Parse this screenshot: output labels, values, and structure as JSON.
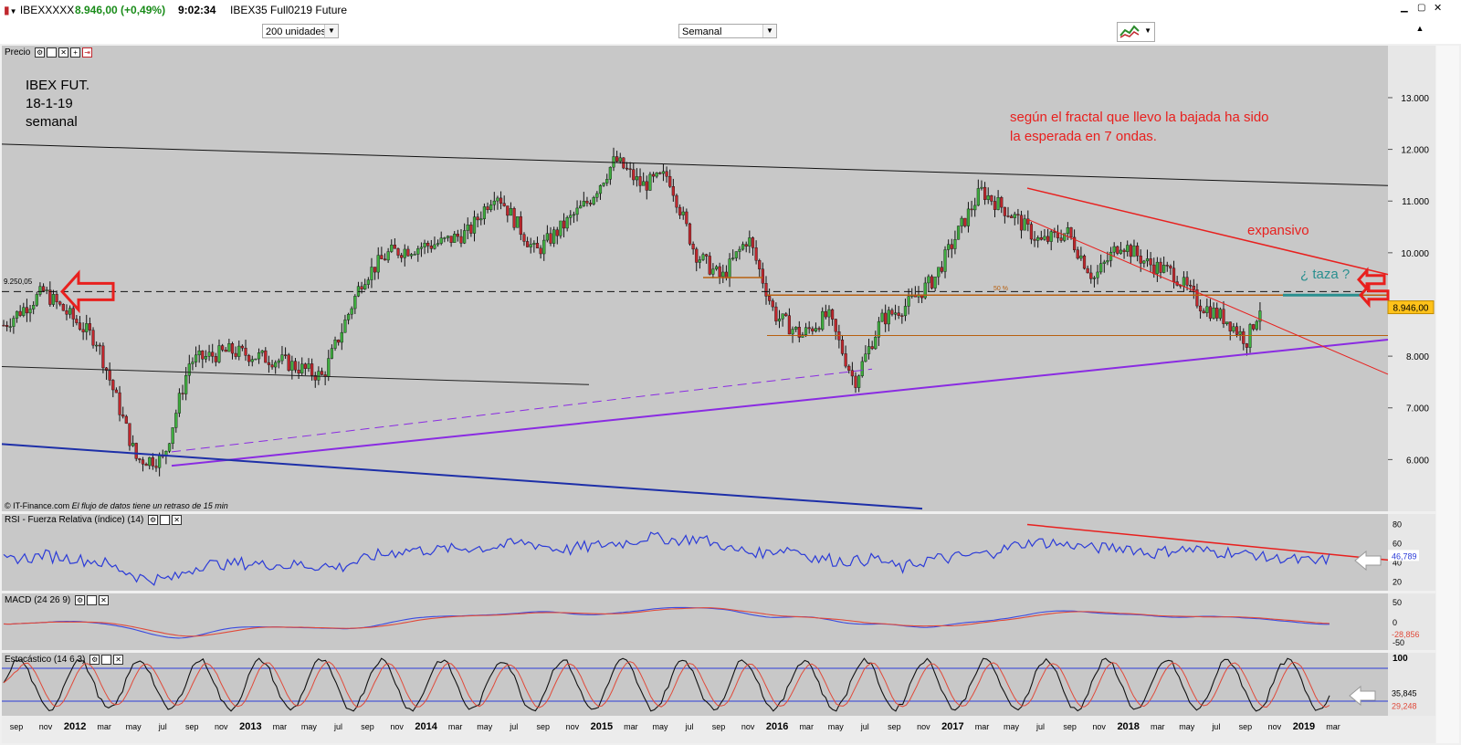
{
  "topbar": {
    "symbol": "IBEXXXXX",
    "quote": "8.946,00 (+0,49%)",
    "time": "9:02:34",
    "description": "IBEX35 Full0219 Future"
  },
  "toolbar": {
    "units_value": "200 unidades",
    "period_value": "Semanal"
  },
  "panels": {
    "price_label": "Precio",
    "rsi_label": "RSI - Fuerza Relativa (índice) (14)",
    "macd_label": "MACD (24 26 9)",
    "stoch_label": "Estocástico (14 6 3)",
    "footer_credit": "© IT-Finance.com",
    "footer_delay": "El flujo de datos tiene un retraso de 15 min"
  },
  "annotations": {
    "title1": "IBEX FUT.",
    "title2": "18-1-19",
    "title3": "semanal",
    "note1": "según el fractal que llevo la bajada ha sido",
    "note2": "la esperada en 7 ondas.",
    "expansivo": "expansivo",
    "taza": "¿ taza ?",
    "level_label": "9.250,05",
    "fib_label": "50 %"
  },
  "colors": {
    "accent_red": "#e8201e",
    "up_candle": "#3fae3f",
    "down_candle": "#c0272d",
    "purple_trend": "#8a2be2",
    "blue_trend": "#1d2fa8",
    "rsi_line": "#2b3bd8",
    "macd_signal": "#e04a3a",
    "orange_level": "#b8600f",
    "teal_taza": "#2a8f8f",
    "panel_bg": "#c7c7c7"
  },
  "chart_data": [
    {
      "type": "candlestick",
      "panel": "Precio",
      "x_labels": [
        "sep",
        "nov",
        "2012",
        "mar",
        "may",
        "jul",
        "sep",
        "nov",
        "2013",
        "mar",
        "may",
        "jul",
        "sep",
        "nov",
        "2014",
        "mar",
        "may",
        "jul",
        "sep",
        "nov",
        "2015",
        "mar",
        "may",
        "jul",
        "sep",
        "nov",
        "2016",
        "mar",
        "may",
        "jul",
        "sep",
        "nov",
        "2017",
        "mar",
        "may",
        "jul",
        "sep",
        "nov",
        "2018",
        "mar",
        "may",
        "jul",
        "sep",
        "nov",
        "2019",
        "mar"
      ],
      "y_ticks": [
        6000,
        7000,
        8000,
        9000,
        10000,
        11000,
        12000,
        13000
      ],
      "y_tick_labels": [
        "6.000",
        "7.000",
        "8.000",
        "9.000",
        "10.000",
        "11.000",
        "12.000",
        "13.000"
      ],
      "ylim": [
        5000,
        13900
      ],
      "last_value": 8946.0,
      "last_value_label": "8.946,00",
      "key_levels": [
        9250.05,
        9180,
        8400
      ],
      "close_path_approx": [
        [
          0,
          8600
        ],
        [
          0.03,
          9250
        ],
        [
          0.07,
          8300
        ],
        [
          0.1,
          6000
        ],
        [
          0.12,
          6000
        ],
        [
          0.14,
          7900
        ],
        [
          0.17,
          8100
        ],
        [
          0.21,
          7900
        ],
        [
          0.24,
          7600
        ],
        [
          0.27,
          9500
        ],
        [
          0.29,
          10000
        ],
        [
          0.31,
          10100
        ],
        [
          0.33,
          10200
        ],
        [
          0.35,
          10400
        ],
        [
          0.37,
          11200
        ],
        [
          0.4,
          10000
        ],
        [
          0.42,
          10500
        ],
        [
          0.44,
          11000
        ],
        [
          0.46,
          11800
        ],
        [
          0.48,
          11300
        ],
        [
          0.5,
          11500
        ],
        [
          0.52,
          10000
        ],
        [
          0.54,
          9500
        ],
        [
          0.56,
          10300
        ],
        [
          0.58,
          8800
        ],
        [
          0.6,
          8400
        ],
        [
          0.62,
          8800
        ],
        [
          0.64,
          7500
        ],
        [
          0.66,
          8700
        ],
        [
          0.68,
          9000
        ],
        [
          0.7,
          9500
        ],
        [
          0.72,
          10500
        ],
        [
          0.735,
          11200
        ],
        [
          0.76,
          10700
        ],
        [
          0.78,
          10200
        ],
        [
          0.8,
          10400
        ],
        [
          0.82,
          9500
        ],
        [
          0.84,
          10200
        ],
        [
          0.86,
          9800
        ],
        [
          0.88,
          9600
        ],
        [
          0.9,
          9000
        ],
        [
          0.92,
          8700
        ],
        [
          0.935,
          8300
        ],
        [
          0.945,
          8946
        ]
      ],
      "trendlines": [
        {
          "name": "top-resistance",
          "color": "black"
        },
        {
          "name": "support-purple",
          "color": "purple"
        },
        {
          "name": "lower-blue",
          "color": "blue"
        },
        {
          "name": "channel-red-upper",
          "color": "red"
        },
        {
          "name": "channel-red-lower",
          "color": "red"
        }
      ]
    },
    {
      "type": "line",
      "panel": "RSI - Fuerza Relativa (índice) (14)",
      "y_ticks": [
        80,
        60,
        40,
        20
      ],
      "last_value": 46.789,
      "last_value_label": "46,789"
    },
    {
      "type": "line",
      "panel": "MACD (24 26 9)",
      "y_ticks": [
        50,
        0,
        -50
      ],
      "last_value": -28.856,
      "last_value_label": "-28,856"
    },
    {
      "type": "line",
      "panel": "Estocástico (14 6 3)",
      "y_ticks": [
        100
      ],
      "values_label": [
        "35,845",
        "29,248"
      ]
    }
  ]
}
